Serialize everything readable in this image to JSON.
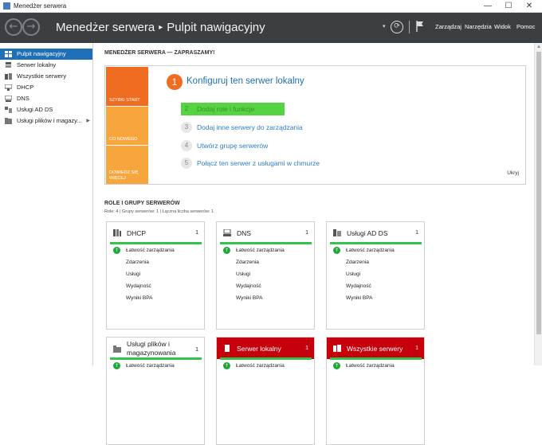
{
  "window": {
    "title": "Menedżer serwera",
    "minimize": "—",
    "maximize": "☐",
    "close": "✕"
  },
  "header": {
    "back_icon": "←",
    "forward_icon": "→",
    "app": "Menedżer serwera",
    "separator": "▸",
    "page": "Pulpit nawigacyjny",
    "menu": [
      "Zarządzaj",
      "Narzędzia",
      "Widok",
      "Pomoc"
    ],
    "refresh_icon": "⟳",
    "dropdown_icon": "▾"
  },
  "sidebar": {
    "items": [
      {
        "label": "Pulpit nawigacyjny",
        "icon": "dashboard-icon"
      },
      {
        "label": "Serwer lokalny",
        "icon": "server-icon"
      },
      {
        "label": "Wszystkie serwery",
        "icon": "servers-icon"
      },
      {
        "label": "DHCP",
        "icon": "dhcp-icon"
      },
      {
        "label": "DNS",
        "icon": "dns-icon"
      },
      {
        "label": "Usługi AD DS",
        "icon": "adds-icon"
      },
      {
        "label": "Usługi plików i magazy...",
        "icon": "file-services-icon",
        "arrow": "▶"
      }
    ]
  },
  "welcome": {
    "title": "MENEDŻER SERWERA — ZAPRASZAMY!",
    "tiles": [
      "SZYBKI START",
      "CO NOWEGO",
      "DOWIEDZ SIĘ WIĘCEJ"
    ],
    "main_step": {
      "num": "1",
      "label": "Konfiguruj ten serwer lokalny"
    },
    "steps": [
      {
        "num": "2",
        "label": "Dodaj role i funkcje"
      },
      {
        "num": "3",
        "label": "Dodaj inne serwery do zarządzania"
      },
      {
        "num": "4",
        "label": "Utwórz grupę serwerów"
      },
      {
        "num": "5",
        "label": "Połącz ten serwer z usługami w chmurze"
      }
    ],
    "hide": "Ukryj"
  },
  "roles": {
    "title": "ROLE I GRUPY SERWERÓW",
    "subtitle": "Role: 4 | Grupy serwerów: 1 | Łączna liczba serwerów: 1",
    "up_icon": "↑",
    "cards": [
      {
        "name": "DHCP",
        "count": "1",
        "rows": [
          "Łatwość zarządzania",
          "Zdarzenia",
          "Usługi",
          "Wydajność",
          "Wyniki BPA"
        ]
      },
      {
        "name": "DNS",
        "count": "1",
        "rows": [
          "Łatwość zarządzania",
          "Zdarzenia",
          "Usługi",
          "Wydajność",
          "Wyniki BPA"
        ]
      },
      {
        "name": "Usługi AD DS",
        "count": "1",
        "rows": [
          "Łatwość zarządzania",
          "Zdarzenia",
          "Usługi",
          "Wydajność",
          "Wyniki BPA"
        ]
      },
      {
        "name": "Usługi plików i magazynowania",
        "count": "1",
        "rows": [
          "Łatwość zarządzania"
        ]
      },
      {
        "name": "Serwer lokalny",
        "count": "1",
        "rows": [
          "Łatwość zarządzania"
        ]
      },
      {
        "name": "Wszystkie serwery",
        "count": "1",
        "rows": [
          "Łatwość zarządzania"
        ]
      }
    ]
  },
  "scroll_up_icon": "▲",
  "colors": {
    "accent": "#1f6fb8",
    "quick_start": "#f06c20",
    "tile_light": "#f7a63e",
    "status_ok": "#34c44b",
    "alert_red": "#c5000b",
    "header_bg": "#3c3f42",
    "highlight": "#56d340"
  }
}
